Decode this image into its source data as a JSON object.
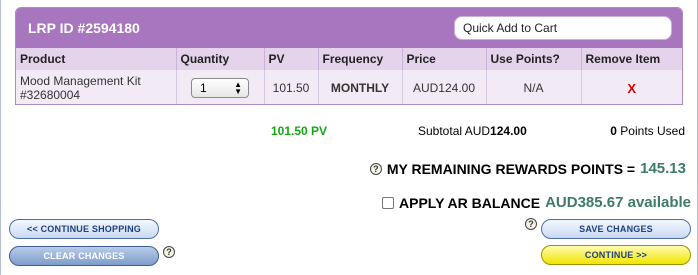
{
  "lrp": {
    "title": "LRP ID #2594180",
    "quick_add_placeholder": "Quick Add to Cart"
  },
  "table": {
    "headers": {
      "product": "Product",
      "quantity": "Quantity",
      "pv": "PV",
      "frequency": "Frequency",
      "price": "Price",
      "use_points": "Use Points?",
      "remove": "Remove Item"
    },
    "rows": [
      {
        "product_name": "Mood Management Kit",
        "product_code": "#32680004",
        "quantity": "1",
        "pv": "101.50",
        "frequency": "MONTHLY",
        "price": "AUD124.00",
        "use_points": "N/A",
        "remove": "X"
      }
    ]
  },
  "summary": {
    "pv_total": "101.50 PV",
    "subtotal_label": "Subtotal AUD",
    "subtotal_value": "124.00",
    "points_used_value": "0",
    "points_used_label": "Points Used"
  },
  "rewards": {
    "help": "?",
    "label": "MY REMAINING REWARDS POINTS =",
    "value": "145.13"
  },
  "ar_balance": {
    "label": "APPLY AR BALANCE",
    "value": "AUD385.67 available"
  },
  "buttons": {
    "continue_shopping": "<< CONTINUE SHOPPING",
    "clear_changes": "CLEAR CHANGES",
    "save_changes": "SAVE CHANGES",
    "continue": "CONTINUE >>"
  },
  "icons": {
    "help": "help-icon",
    "select_arrows": "updown-arrows-icon",
    "checkbox": "checkbox"
  },
  "colors": {
    "header_purple": "#a875bf",
    "pv_green": "#14a614",
    "reward_teal": "#3d7a68",
    "remove_red": "#e00000",
    "continue_yellow": "#f1e500"
  }
}
